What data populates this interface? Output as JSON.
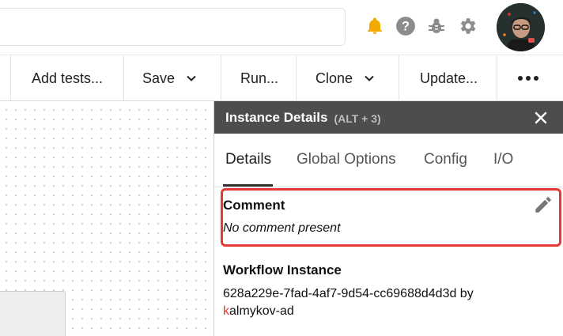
{
  "header": {
    "icons": [
      "bell-icon",
      "help-icon",
      "bug-icon",
      "gear-icon"
    ],
    "bell_color": "#f2a900",
    "icon_color": "#8c8c8c"
  },
  "toolbar": {
    "add_tests_label": "Add tests...",
    "save_label": "Save",
    "run_label": "Run...",
    "clone_label": "Clone",
    "update_label": "Update..."
  },
  "panel": {
    "title": "Instance Details",
    "shortcut": "(ALT + 3)",
    "tabs": [
      {
        "label": "Details",
        "active": true
      },
      {
        "label": "Global Options",
        "active": false
      },
      {
        "label": "Config",
        "active": false
      },
      {
        "label": "I/O",
        "active": false
      }
    ],
    "comment": {
      "title": "Comment",
      "value": "No comment present"
    },
    "workflow_instance": {
      "title": "Workflow Instance",
      "id": "628a229e-7fad-4af7-9d54-cc69688d4d3d by",
      "author_first_letter": "k",
      "author_rest": "almykov-ad"
    },
    "highlight_color": "#e53935"
  }
}
